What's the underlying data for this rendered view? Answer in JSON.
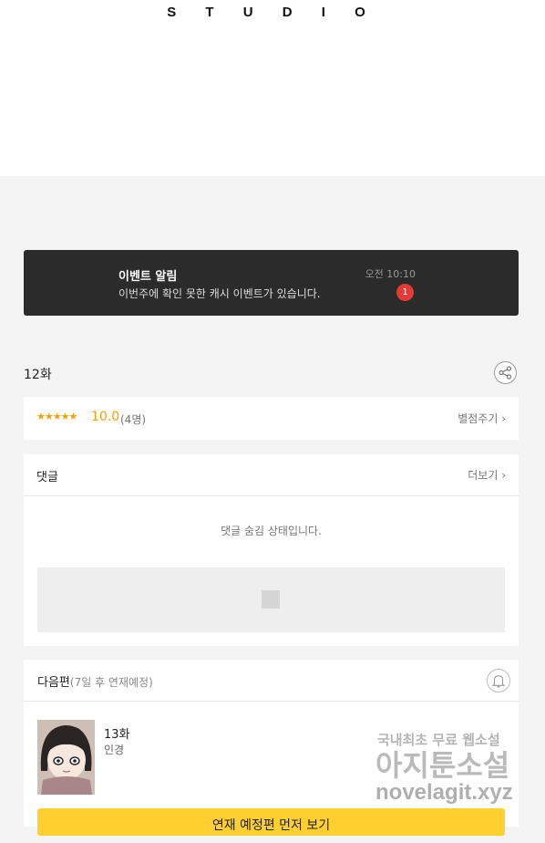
{
  "header": {
    "logo": "S T U D I O"
  },
  "banner": {
    "title": "이벤트 알림",
    "desc": "이번주에 확인 못한 캐시 이벤트가 있습니다.",
    "time": "오전 10:10",
    "badge": "1"
  },
  "episode": {
    "title": "12화"
  },
  "rating": {
    "stars": "★★★★★",
    "score": "10.0",
    "count": "(4명)",
    "rate_label": "별점주기 ›"
  },
  "comments": {
    "label": "댓글",
    "more": "더보기 ›",
    "hidden_msg": "댓글 숨김 상태입니다."
  },
  "next": {
    "label": "다음편",
    "sub": "(7일 후 연재예정)",
    "ep_title": "13화",
    "ep_sub": "인경",
    "button": "연재 예정편 먼저 보기"
  },
  "watermark": {
    "line1": "국내최초 무료 웹소설",
    "line2": "아지툰소설",
    "line3": "novelagit.xyz"
  }
}
